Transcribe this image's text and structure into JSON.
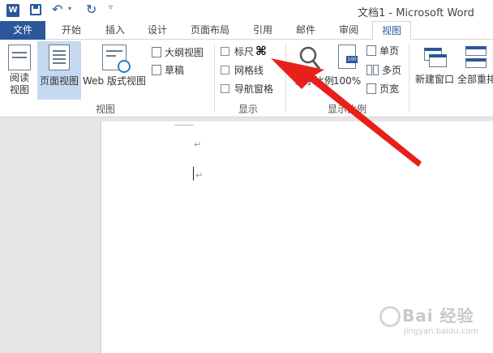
{
  "titlebar": {
    "word_logo": "W",
    "doc_title": "文档1 - Microsoft Word"
  },
  "tabs": [
    {
      "label": "文件"
    },
    {
      "label": "开始"
    },
    {
      "label": "插入"
    },
    {
      "label": "设计"
    },
    {
      "label": "页面布局"
    },
    {
      "label": "引用"
    },
    {
      "label": "邮件"
    },
    {
      "label": "审阅"
    },
    {
      "label": "视图"
    }
  ],
  "ribbon": {
    "views": {
      "read_mode": "阅读\n视图",
      "print_layout": "页面视图",
      "web_layout": "Web 版式视图",
      "outline": "大纲视图",
      "draft": "草稿",
      "group_label": "视图"
    },
    "show": {
      "ruler": "标尺",
      "ruler_suffix": "⌘",
      "gridlines": "网格线",
      "nav_pane": "导航窗格",
      "group_label": "显示"
    },
    "zoom": {
      "zoom": "显示比例",
      "hundred": "100%",
      "one_page": "单页",
      "multi_page": "多页",
      "page_width": "页宽",
      "group_label": "显示比例"
    },
    "window": {
      "new_window": "新建窗口",
      "arrange_all": "全部重排"
    }
  },
  "document": {
    "para_mark": "↵"
  },
  "watermark": {
    "main": "Bai 经验",
    "sub": "jingyan.baidu.com"
  },
  "colors": {
    "accent": "#2b579a",
    "arrow": "#e8201a",
    "selected": "#c5d9f1"
  }
}
